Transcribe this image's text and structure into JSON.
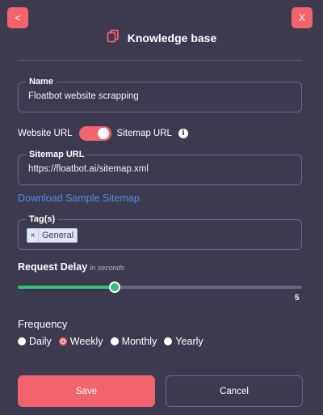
{
  "header": {
    "back_label": "<",
    "close_label": "X",
    "title": "Knowledge base",
    "icon": "copy-icon"
  },
  "name_field": {
    "label": "Name",
    "value": "Floatbot website scrapping"
  },
  "url_toggle": {
    "left_label": "Website URL",
    "right_label": "Sitemap URL",
    "state": "sitemap",
    "info_icon": "info-icon",
    "accent": "#f1636d"
  },
  "sitemap_field": {
    "label": "Sitemap URL",
    "value": "https://floatbot.ai/sitemap.xml"
  },
  "download_link": "Download Sample Sitemap",
  "tags_field": {
    "label": "Tag(s)",
    "tags": [
      {
        "remove": "×",
        "label": "General"
      }
    ]
  },
  "request_delay": {
    "label": "Request Delay",
    "unit_hint": "in seconds",
    "value": 5,
    "value_label": "5",
    "fill_fraction": 0.34,
    "accent": "#2fc07a"
  },
  "frequency": {
    "label": "Frequency",
    "options": [
      "Daily",
      "Weekly",
      "Monthly",
      "Yearly"
    ],
    "selected": "Weekly"
  },
  "actions": {
    "save_label": "Save",
    "cancel_label": "Cancel"
  }
}
